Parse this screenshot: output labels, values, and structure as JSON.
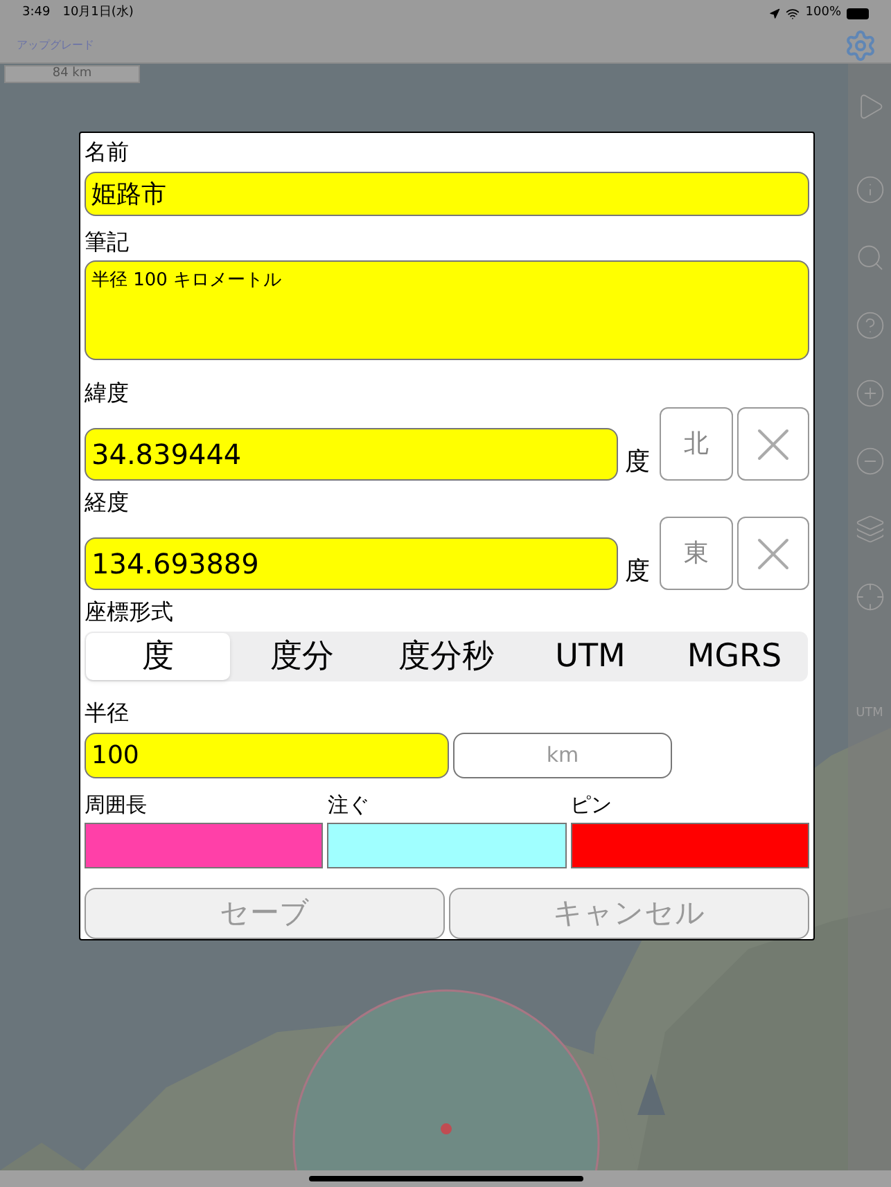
{
  "status_bar": {
    "time": "3:49",
    "date": "10月1日(水)",
    "battery": "100%"
  },
  "nav_bar": {
    "upgrade_link": "アップグレード"
  },
  "map": {
    "scale": "84 km",
    "toolbar_label": "UTM"
  },
  "dialog": {
    "name": {
      "label": "名前",
      "value": "姫路市"
    },
    "note": {
      "label": "筆記",
      "value": "半径 100 キロメートル"
    },
    "latitude": {
      "label": "緯度",
      "value": "34.839444",
      "unit": "度",
      "hemisphere": "北"
    },
    "longitude": {
      "label": "経度",
      "value": "134.693889",
      "unit": "度",
      "hemisphere": "東"
    },
    "format": {
      "label": "座標形式",
      "options": [
        {
          "label": "度",
          "selected": true
        },
        {
          "label": "度分",
          "selected": false
        },
        {
          "label": "度分秒",
          "selected": false
        },
        {
          "label": "UTM",
          "selected": false
        },
        {
          "label": "MGRS",
          "selected": false
        }
      ]
    },
    "radius": {
      "label": "半径",
      "value": "100",
      "unit": "km"
    },
    "colors": [
      {
        "label": "周囲長",
        "color": "#ff40a8"
      },
      {
        "label": "注ぐ",
        "color": "#a0ffff"
      },
      {
        "label": "ピン",
        "color": "#ff0000"
      }
    ],
    "buttons": [
      "セーブ",
      "キャンセル"
    ]
  }
}
